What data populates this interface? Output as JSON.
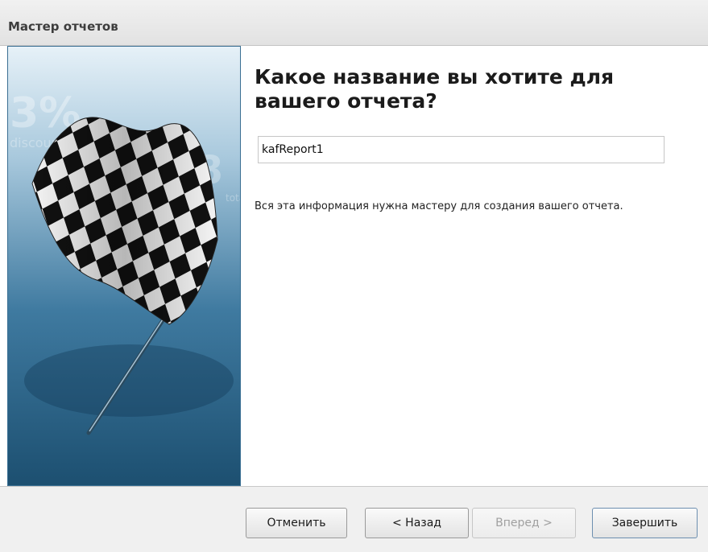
{
  "window": {
    "title": "Мастер отчетов"
  },
  "banner": {
    "icon": "checkered-flag-icon"
  },
  "main": {
    "heading": "Какое название вы хотите для вашего отчета?",
    "report_name_value": "kafReport1",
    "info_text": "Вся эта информация нужна мастеру для создания вашего отчета."
  },
  "buttons": {
    "cancel": "Отменить",
    "back": "< Назад",
    "next": "Вперед >",
    "finish": "Завершить"
  },
  "state": {
    "next_enabled": false
  },
  "colors": {
    "banner_dark": "#1c4f70",
    "banner_light": "#cfe3ef",
    "primary_border": "#6d8fb0"
  }
}
